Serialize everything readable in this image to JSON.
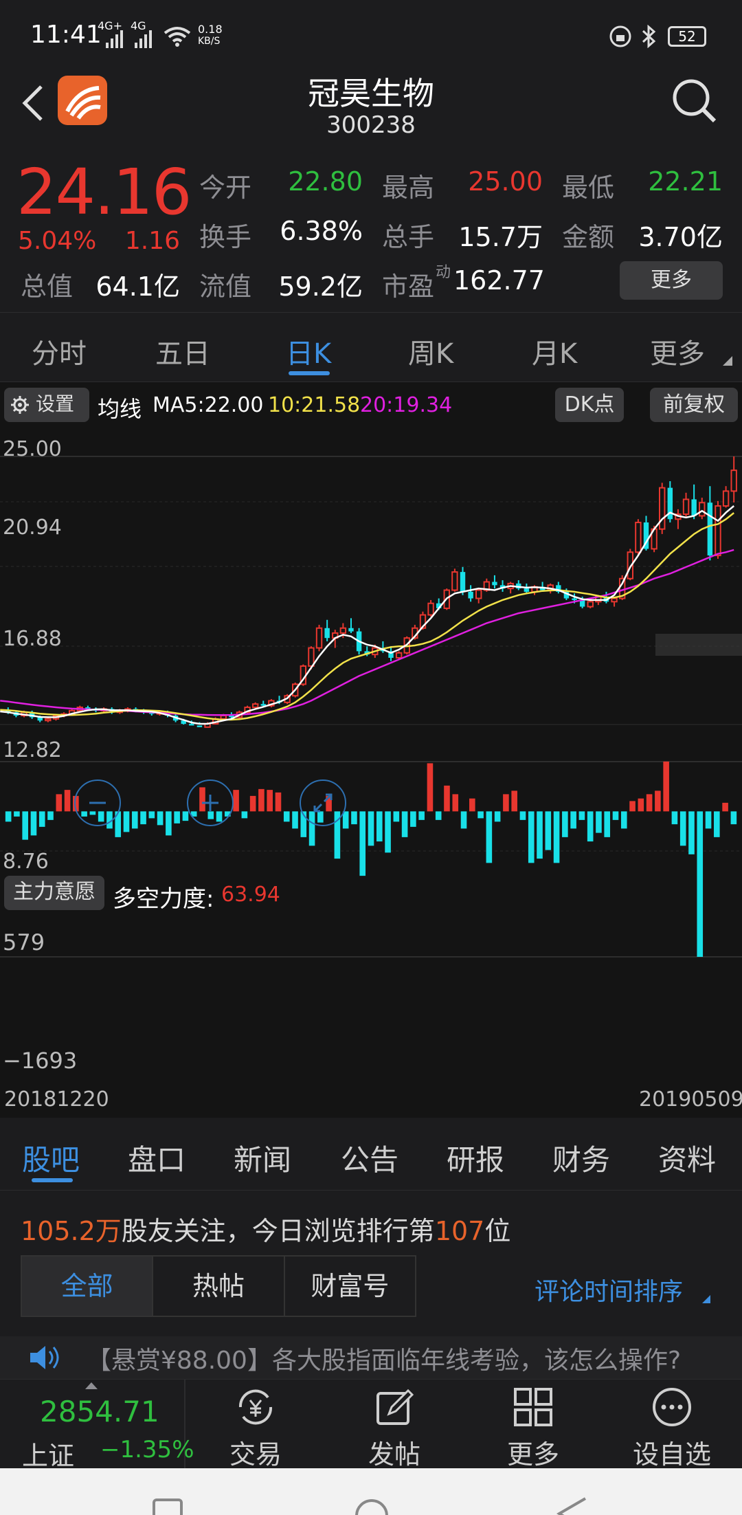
{
  "status_bar": {
    "time": "11:41",
    "signal1": "4G+",
    "signal2": "4G",
    "net_speed": "0.18",
    "net_unit": "KB/S",
    "battery": "52"
  },
  "header": {
    "title": "冠昊生物",
    "code": "300238"
  },
  "quote": {
    "price": "24.16",
    "change_pct": "5.04%",
    "change_amt": "1.16",
    "open_label": "今开",
    "open_value": "22.80",
    "high_label": "最高",
    "high_value": "25.00",
    "low_label": "最低",
    "low_value": "22.21",
    "turnover_label": "换手",
    "turnover_value": "6.38%",
    "volume_label": "总手",
    "volume_value": "15.7万",
    "amount_label": "金额",
    "amount_value": "3.70亿",
    "mktcap_label": "总值",
    "mktcap_value": "64.1亿",
    "float_label": "流值",
    "float_value": "59.2亿",
    "pe_label": "市盈",
    "pe_sup": "动",
    "pe_value": "162.77",
    "more_label": "更多"
  },
  "tabs": [
    "分时",
    "五日",
    "日K",
    "周K",
    "月K",
    "更多"
  ],
  "active_tab": 2,
  "chart": {
    "settings_label": "设置",
    "ma_prefix": "均线",
    "ma5": "MA5:22.00",
    "ma10": "10:21.58",
    "ma20": "20:19.34",
    "dk_label": "DK点",
    "adjust_label": "前复权",
    "y_labels": [
      "25.00",
      "20.94",
      "16.88",
      "12.82",
      "8.76"
    ],
    "indicator_btn": "主力意愿",
    "indicator_name": "多空力度:",
    "indicator_value": "63.94",
    "ind_y_top": "579",
    "ind_y_bottom": "−1693",
    "date_start": "20181220",
    "date_end": "20190509",
    "colors": {
      "ma5": "#ffffff",
      "ma10": "#f2e24a",
      "ma20": "#e020e0",
      "up": "#e8372f",
      "down": "#19e0e8"
    }
  },
  "chart_data": {
    "type": "candlestick",
    "ylim": [
      8.76,
      25.0
    ],
    "x_range": [
      "20181220",
      "20190509"
    ],
    "candles": [
      [
        9.6,
        9.8,
        9.4,
        9.5
      ],
      [
        9.5,
        9.6,
        9.2,
        9.3
      ],
      [
        9.3,
        9.6,
        9.2,
        9.5
      ],
      [
        9.5,
        9.6,
        9.1,
        9.2
      ],
      [
        9.2,
        9.3,
        8.9,
        9.0
      ],
      [
        9.0,
        9.2,
        8.9,
        9.1
      ],
      [
        9.1,
        9.4,
        9.0,
        9.3
      ],
      [
        9.3,
        9.5,
        9.2,
        9.4
      ],
      [
        9.4,
        9.7,
        9.3,
        9.6
      ],
      [
        9.6,
        9.9,
        9.5,
        9.8
      ],
      [
        9.8,
        9.9,
        9.6,
        9.7
      ],
      [
        9.7,
        9.8,
        9.5,
        9.6
      ],
      [
        9.6,
        9.8,
        9.5,
        9.7
      ],
      [
        9.7,
        9.8,
        9.4,
        9.5
      ],
      [
        9.5,
        9.7,
        9.4,
        9.6
      ],
      [
        9.6,
        9.8,
        9.5,
        9.7
      ],
      [
        9.7,
        9.8,
        9.5,
        9.6
      ],
      [
        9.6,
        9.7,
        9.4,
        9.5
      ],
      [
        9.5,
        9.6,
        9.3,
        9.4
      ],
      [
        9.4,
        9.6,
        9.3,
        9.5
      ],
      [
        9.5,
        9.6,
        9.2,
        9.3
      ],
      [
        9.3,
        9.4,
        8.9,
        9.0
      ],
      [
        9.0,
        9.1,
        8.7,
        8.8
      ],
      [
        8.8,
        9.0,
        8.6,
        8.7
      ],
      [
        8.7,
        8.9,
        8.5,
        8.6
      ],
      [
        8.6,
        8.9,
        8.5,
        8.8
      ],
      [
        8.8,
        9.2,
        8.7,
        9.1
      ],
      [
        9.1,
        9.4,
        9.0,
        9.3
      ],
      [
        9.3,
        9.5,
        9.1,
        9.2
      ],
      [
        9.2,
        9.6,
        9.1,
        9.5
      ],
      [
        9.5,
        9.9,
        9.4,
        9.8
      ],
      [
        9.8,
        10.1,
        9.7,
        10.0
      ],
      [
        10.0,
        10.2,
        9.8,
        9.9
      ],
      [
        9.9,
        10.3,
        9.8,
        10.2
      ],
      [
        10.2,
        10.5,
        10.0,
        10.1
      ],
      [
        10.1,
        10.6,
        10.0,
        10.5
      ],
      [
        10.5,
        11.3,
        10.4,
        11.2
      ],
      [
        11.2,
        12.4,
        11.1,
        12.3
      ],
      [
        12.3,
        13.5,
        12.1,
        13.4
      ],
      [
        13.4,
        14.8,
        13.2,
        14.6
      ],
      [
        14.6,
        15.1,
        13.8,
        14.0
      ],
      [
        14.0,
        14.5,
        13.4,
        14.3
      ],
      [
        14.3,
        14.9,
        14.0,
        14.6
      ],
      [
        14.6,
        15.2,
        14.3,
        14.4
      ],
      [
        14.4,
        14.6,
        13.0,
        13.2
      ],
      [
        13.2,
        13.5,
        12.9,
        13.0
      ],
      [
        13.0,
        13.6,
        12.8,
        13.4
      ],
      [
        13.4,
        13.8,
        13.1,
        13.2
      ],
      [
        13.2,
        13.5,
        12.6,
        12.8
      ],
      [
        12.8,
        13.2,
        12.7,
        13.1
      ],
      [
        13.1,
        14.1,
        13.0,
        14.0
      ],
      [
        14.0,
        14.8,
        13.9,
        14.6
      ],
      [
        14.6,
        15.6,
        14.5,
        15.4
      ],
      [
        15.4,
        16.3,
        15.3,
        16.1
      ],
      [
        16.1,
        16.4,
        15.7,
        15.8
      ],
      [
        15.8,
        17.0,
        15.7,
        16.9
      ],
      [
        16.9,
        18.2,
        16.8,
        18.0
      ],
      [
        18.0,
        18.3,
        16.6,
        16.8
      ],
      [
        16.8,
        17.2,
        16.2,
        16.4
      ],
      [
        16.4,
        17.0,
        16.1,
        16.9
      ],
      [
        16.9,
        17.6,
        16.8,
        17.4
      ],
      [
        17.4,
        17.8,
        17.0,
        17.2
      ],
      [
        17.2,
        17.5,
        16.8,
        17.0
      ],
      [
        17.0,
        17.4,
        16.7,
        17.3
      ],
      [
        17.3,
        17.5,
        16.9,
        17.0
      ],
      [
        17.0,
        17.3,
        16.7,
        16.8
      ],
      [
        16.8,
        17.2,
        16.6,
        17.1
      ],
      [
        17.1,
        17.4,
        16.8,
        16.9
      ],
      [
        16.9,
        17.3,
        16.7,
        17.2
      ],
      [
        17.2,
        17.4,
        16.7,
        16.8
      ],
      [
        16.8,
        17.0,
        16.3,
        16.4
      ],
      [
        16.4,
        16.7,
        16.1,
        16.3
      ],
      [
        16.3,
        16.5,
        15.8,
        15.9
      ],
      [
        15.9,
        16.4,
        15.8,
        16.2
      ],
      [
        16.2,
        16.6,
        16.0,
        16.5
      ],
      [
        16.5,
        16.8,
        16.1,
        16.2
      ],
      [
        16.2,
        16.5,
        15.9,
        16.4
      ],
      [
        16.4,
        17.8,
        16.3,
        17.6
      ],
      [
        17.6,
        19.4,
        17.5,
        19.2
      ],
      [
        19.2,
        21.2,
        19.0,
        21.0
      ],
      [
        21.0,
        21.4,
        19.3,
        19.4
      ],
      [
        19.4,
        20.8,
        19.2,
        20.6
      ],
      [
        20.6,
        23.4,
        20.3,
        23.1
      ],
      [
        23.1,
        23.5,
        21.0,
        21.2
      ],
      [
        21.2,
        21.8,
        20.6,
        21.5
      ],
      [
        21.5,
        22.8,
        21.3,
        22.4
      ],
      [
        22.4,
        23.3,
        21.2,
        21.4
      ],
      [
        21.4,
        22.5,
        21.2,
        22.2
      ],
      [
        22.2,
        23.2,
        18.7,
        19.0
      ],
      [
        19.0,
        22.3,
        18.8,
        22.0
      ],
      [
        22.0,
        23.2,
        21.9,
        22.9
      ],
      [
        22.9,
        25.0,
        22.21,
        24.16
      ]
    ],
    "ma5": [
      9.55,
      9.5,
      9.42,
      9.36,
      9.3,
      9.22,
      9.2,
      9.2,
      9.28,
      9.42,
      9.52,
      9.62,
      9.68,
      9.68,
      9.62,
      9.62,
      9.62,
      9.58,
      9.56,
      9.54,
      9.46,
      9.34,
      9.18,
      9.04,
      8.88,
      8.8,
      8.8,
      8.9,
      9.0,
      9.1,
      9.33,
      9.56,
      9.7,
      9.83,
      9.98,
      10.12,
      10.35,
      10.86,
      11.5,
      12.2,
      12.9,
      13.5,
      14.0,
      14.2,
      14.1,
      13.8,
      13.6,
      13.5,
      13.3,
      13.1,
      13.3,
      13.6,
      14.1,
      14.7,
      15.2,
      15.8,
      16.4,
      16.7,
      16.8,
      16.9,
      17.0,
      16.95,
      16.9,
      17.05,
      17.15,
      17.1,
      17.05,
      17.08,
      17.05,
      17.0,
      16.9,
      16.7,
      16.5,
      16.35,
      16.3,
      16.3,
      16.3,
      16.6,
      17.3,
      18.3,
      19.0,
      19.8,
      20.6,
      21.2,
      21.6,
      21.4,
      21.3,
      21.4,
      21.7,
      21.4,
      21.1,
      21.6,
      22.0
    ],
    "ma10": [
      9.65,
      9.62,
      9.58,
      9.52,
      9.48,
      9.42,
      9.38,
      9.35,
      9.33,
      9.33,
      9.35,
      9.38,
      9.42,
      9.48,
      9.52,
      9.57,
      9.6,
      9.62,
      9.62,
      9.6,
      9.58,
      9.52,
      9.45,
      9.38,
      9.3,
      9.22,
      9.14,
      9.08,
      9.05,
      9.05,
      9.08,
      9.15,
      9.26,
      9.38,
      9.52,
      9.68,
      9.85,
      10.1,
      10.45,
      10.85,
      11.3,
      11.75,
      12.15,
      12.5,
      12.75,
      12.9,
      13.05,
      13.2,
      13.35,
      13.45,
      13.5,
      13.5,
      13.55,
      13.65,
      13.8,
      14.05,
      14.35,
      14.7,
      15.05,
      15.35,
      15.65,
      15.9,
      16.1,
      16.3,
      16.45,
      16.6,
      16.7,
      16.78,
      16.85,
      16.88,
      16.9,
      16.85,
      16.8,
      16.72,
      16.65,
      16.55,
      16.45,
      16.45,
      16.55,
      16.8,
      17.15,
      17.6,
      18.1,
      18.6,
      19.1,
      19.5,
      19.9,
      20.3,
      20.6,
      20.8,
      20.9,
      21.2,
      21.58
    ],
    "ma20": [
      10.2,
      10.15,
      10.08,
      10.02,
      9.96,
      9.9,
      9.85,
      9.8,
      9.76,
      9.72,
      9.7,
      9.68,
      9.66,
      9.64,
      9.62,
      9.6,
      9.58,
      9.55,
      9.52,
      9.5,
      9.47,
      9.44,
      9.41,
      9.38,
      9.36,
      9.35,
      9.34,
      9.33,
      9.33,
      9.34,
      9.36,
      9.39,
      9.43,
      9.48,
      9.55,
      9.63,
      9.72,
      9.85,
      10.0,
      10.2,
      10.45,
      10.7,
      10.95,
      11.2,
      11.45,
      11.7,
      11.9,
      12.1,
      12.3,
      12.5,
      12.7,
      12.9,
      13.1,
      13.3,
      13.5,
      13.7,
      13.9,
      14.1,
      14.3,
      14.5,
      14.7,
      14.9,
      15.05,
      15.2,
      15.35,
      15.5,
      15.6,
      15.7,
      15.8,
      15.9,
      16.0,
      16.1,
      16.2,
      16.3,
      16.4,
      16.5,
      16.6,
      16.75,
      16.9,
      17.05,
      17.2,
      17.4,
      17.6,
      17.75,
      17.9,
      18.1,
      18.3,
      18.5,
      18.7,
      18.9,
      19.1,
      19.2,
      19.34
    ]
  },
  "indicator_data": {
    "type": "bar",
    "ylim": [
      -1693,
      579
    ],
    "values": [
      -120,
      -60,
      -330,
      -280,
      -180,
      -100,
      200,
      250,
      180,
      -60,
      -40,
      -120,
      -200,
      -300,
      -240,
      -200,
      -150,
      -80,
      -160,
      -280,
      -140,
      -110,
      -60,
      280,
      -90,
      -120,
      -60,
      250,
      -80,
      180,
      260,
      250,
      220,
      -120,
      -200,
      -300,
      -400,
      -130,
      180,
      -550,
      -200,
      -150,
      -750,
      -400,
      -350,
      -480,
      -120,
      -300,
      -180,
      -100,
      560,
      -100,
      300,
      200,
      -200,
      150,
      -80,
      -600,
      -120,
      200,
      240,
      -100,
      -600,
      -550,
      -450,
      -600,
      -300,
      -200,
      -100,
      -350,
      -250,
      -300,
      -100,
      -200,
      120,
      150,
      200,
      240,
      580,
      -150,
      -400,
      -500,
      -1693,
      -200,
      -300,
      100,
      -150
    ]
  },
  "forum": {
    "followers": "105.2万",
    "followers_text": "股友关注，今日浏览排行第",
    "rank": "107",
    "rank_suffix": "位",
    "filters": [
      "全部",
      "热帖",
      "财富号"
    ],
    "sort_label": "评论时间排序",
    "ticker_text": "【悬赏¥88.00】各大股指面临年线考验，该怎么操作?"
  },
  "subtabs": [
    "股吧",
    "盘口",
    "新闻",
    "公告",
    "研报",
    "财务",
    "资料"
  ],
  "bottom_nav": {
    "index_value": "2854.71",
    "index_name": "上证",
    "index_change": "−1.35%",
    "items": [
      "交易",
      "发帖",
      "更多",
      "设自选"
    ]
  }
}
